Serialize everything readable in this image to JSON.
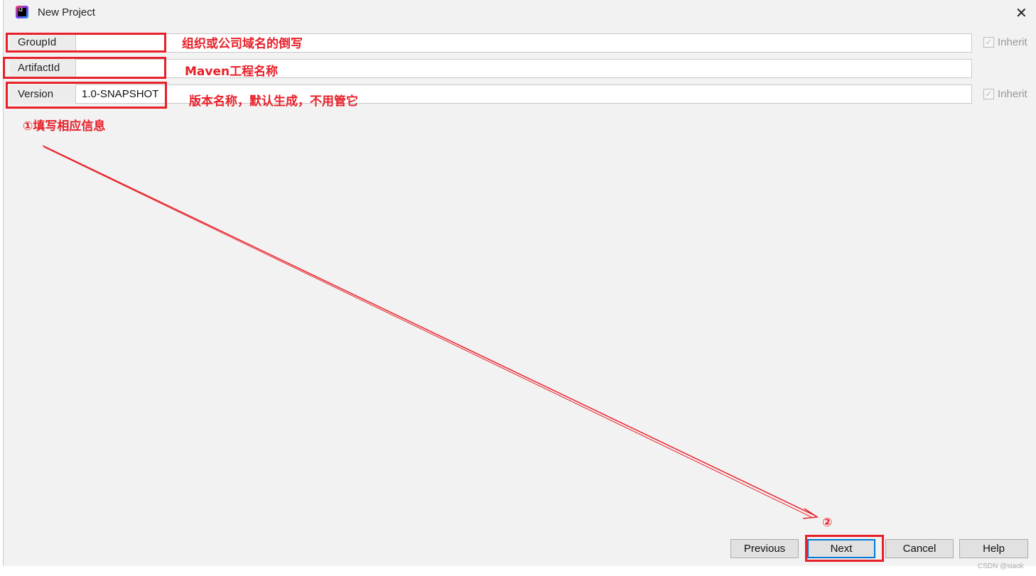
{
  "window": {
    "title": "New Project",
    "close_icon": "close-icon",
    "app_icon": "intellij-idea-icon"
  },
  "form": {
    "group_id": {
      "label": "GroupId",
      "value": "",
      "inherit_label": "Inherit",
      "inherit_checked": true
    },
    "artifact_id": {
      "label": "ArtifactId",
      "value": ""
    },
    "version": {
      "label": "Version",
      "value": "1.0-SNAPSHOT",
      "inherit_label": "Inherit",
      "inherit_checked": true
    }
  },
  "annotations": {
    "group_id_note": "组织或公司域名的倒写",
    "artifact_id_note": "Maven工程名称",
    "version_note": "版本名称，默认生成，不用管它",
    "step1": "①填写相应信息",
    "step2": "②",
    "color": "#e8202a"
  },
  "buttons": {
    "previous": "Previous",
    "next": "Next",
    "cancel": "Cancel",
    "help": "Help"
  },
  "watermark": "CSDN @siaok"
}
